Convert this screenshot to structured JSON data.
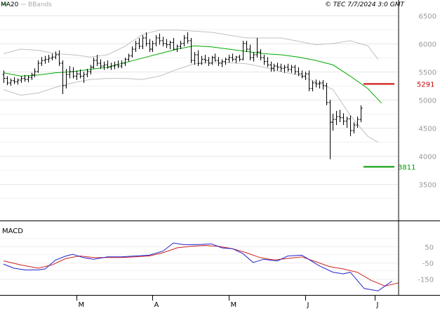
{
  "chart_data": [
    {
      "type": "ohlc",
      "header": {
        "ma_label": "MA20",
        "bb_label": "BBands",
        "source_label": "© TEC 7/7/2024 3:0 GMT"
      },
      "colors": {
        "candle": "#000000",
        "ma": "#00aa00",
        "bands": "#c0c0c0",
        "resistance": "#cc0000",
        "support": "#009900",
        "grid": "#e6e6e6"
      },
      "ylim": [
        3000,
        6600
      ],
      "y_ticks": [
        3500,
        4000,
        4500,
        5000,
        5500,
        6000,
        6500
      ],
      "x_labels": [
        "M",
        "A",
        "M",
        "J",
        "J"
      ],
      "x_label_index": [
        21,
        43,
        65,
        87,
        107
      ],
      "levels": [
        {
          "name": "resistance",
          "value": 5291,
          "label": "5291"
        },
        {
          "name": "support",
          "value": 3811,
          "label": "3811"
        }
      ],
      "ohlc": [
        [
          5450,
          5520,
          5300,
          5380
        ],
        [
          5380,
          5420,
          5260,
          5300
        ],
        [
          5300,
          5380,
          5250,
          5340
        ],
        [
          5340,
          5400,
          5280,
          5320
        ],
        [
          5320,
          5380,
          5270,
          5350
        ],
        [
          5350,
          5420,
          5300,
          5380
        ],
        [
          5380,
          5440,
          5320,
          5360
        ],
        [
          5360,
          5430,
          5310,
          5400
        ],
        [
          5400,
          5480,
          5350,
          5440
        ],
        [
          5440,
          5560,
          5400,
          5500
        ],
        [
          5500,
          5700,
          5480,
          5650
        ],
        [
          5650,
          5760,
          5600,
          5700
        ],
        [
          5700,
          5780,
          5640,
          5720
        ],
        [
          5720,
          5800,
          5660,
          5740
        ],
        [
          5740,
          5820,
          5700,
          5760
        ],
        [
          5760,
          5860,
          5720,
          5800
        ],
        [
          5800,
          5880,
          5600,
          5650
        ],
        [
          5650,
          5700,
          5100,
          5250
        ],
        [
          5250,
          5550,
          5200,
          5450
        ],
        [
          5450,
          5600,
          5380,
          5500
        ],
        [
          5500,
          5580,
          5380,
          5420
        ],
        [
          5420,
          5520,
          5350,
          5460
        ],
        [
          5460,
          5540,
          5380,
          5420
        ],
        [
          5420,
          5500,
          5300,
          5450
        ],
        [
          5450,
          5550,
          5400,
          5500
        ],
        [
          5500,
          5620,
          5450,
          5580
        ],
        [
          5580,
          5750,
          5550,
          5700
        ],
        [
          5700,
          5800,
          5600,
          5650
        ],
        [
          5650,
          5720,
          5550,
          5600
        ],
        [
          5600,
          5680,
          5530,
          5620
        ],
        [
          5620,
          5700,
          5550,
          5580
        ],
        [
          5580,
          5660,
          5530,
          5600
        ],
        [
          5600,
          5680,
          5540,
          5620
        ],
        [
          5620,
          5700,
          5560,
          5600
        ],
        [
          5600,
          5700,
          5560,
          5650
        ],
        [
          5650,
          5750,
          5600,
          5720
        ],
        [
          5720,
          5820,
          5680,
          5780
        ],
        [
          5780,
          5950,
          5750,
          5900
        ],
        [
          5900,
          6050,
          5850,
          6000
        ],
        [
          6000,
          6100,
          5900,
          5950
        ],
        [
          5950,
          6150,
          5900,
          6100
        ],
        [
          6100,
          6200,
          5950,
          6000
        ],
        [
          6000,
          6080,
          5850,
          5900
        ],
        [
          5900,
          6050,
          5850,
          6000
        ],
        [
          6000,
          6150,
          5950,
          6100
        ],
        [
          6100,
          6180,
          5980,
          6050
        ],
        [
          6050,
          6120,
          5950,
          6000
        ],
        [
          6000,
          6080,
          5920,
          5980
        ],
        [
          5980,
          6050,
          5900,
          6020
        ],
        [
          6020,
          6100,
          5880,
          5900
        ],
        [
          5900,
          5980,
          5850,
          5950
        ],
        [
          5950,
          6050,
          5900,
          6000
        ],
        [
          6000,
          6150,
          5950,
          6100
        ],
        [
          6100,
          6200,
          6000,
          6050
        ],
        [
          6050,
          6100,
          5650,
          5700
        ],
        [
          5700,
          5850,
          5620,
          5800
        ],
        [
          5800,
          5880,
          5600,
          5650
        ],
        [
          5650,
          5780,
          5620,
          5720
        ],
        [
          5720,
          5800,
          5650,
          5700
        ],
        [
          5700,
          5760,
          5600,
          5650
        ],
        [
          5650,
          5780,
          5620,
          5750
        ],
        [
          5750,
          5820,
          5680,
          5700
        ],
        [
          5700,
          5760,
          5600,
          5650
        ],
        [
          5650,
          5720,
          5580,
          5680
        ],
        [
          5680,
          5750,
          5620,
          5720
        ],
        [
          5720,
          5800,
          5660,
          5750
        ],
        [
          5750,
          5820,
          5680,
          5720
        ],
        [
          5720,
          5780,
          5650,
          5760
        ],
        [
          5760,
          5800,
          5680,
          5720
        ],
        [
          5720,
          6050,
          5700,
          6000
        ],
        [
          6000,
          6050,
          5850,
          5900
        ],
        [
          5900,
          5980,
          5700,
          5750
        ],
        [
          5750,
          5850,
          5680,
          5800
        ],
        [
          5800,
          6100,
          5750,
          5850
        ],
        [
          5850,
          5900,
          5700,
          5750
        ],
        [
          5750,
          5800,
          5620,
          5680
        ],
        [
          5680,
          5760,
          5580,
          5620
        ],
        [
          5620,
          5680,
          5500,
          5560
        ],
        [
          5560,
          5640,
          5500,
          5600
        ],
        [
          5600,
          5660,
          5520,
          5580
        ],
        [
          5580,
          5640,
          5500,
          5560
        ],
        [
          5560,
          5620,
          5480,
          5580
        ],
        [
          5580,
          5640,
          5500,
          5540
        ],
        [
          5540,
          5620,
          5480,
          5580
        ],
        [
          5580,
          5620,
          5450,
          5500
        ],
        [
          5500,
          5580,
          5420,
          5460
        ],
        [
          5460,
          5520,
          5380,
          5420
        ],
        [
          5420,
          5500,
          5350,
          5460
        ],
        [
          5460,
          5520,
          5150,
          5200
        ],
        [
          5200,
          5340,
          5150,
          5300
        ],
        [
          5300,
          5360,
          5220,
          5280
        ],
        [
          5280,
          5340,
          5200,
          5300
        ],
        [
          5300,
          5350,
          5180,
          5250
        ],
        [
          5250,
          5300,
          4900,
          4950
        ],
        [
          4950,
          5000,
          3940,
          4600
        ],
        [
          4600,
          4750,
          4450,
          4650
        ],
        [
          4650,
          4800,
          4550,
          4700
        ],
        [
          4700,
          4820,
          4600,
          4680
        ],
        [
          4680,
          4760,
          4550,
          4620
        ],
        [
          4620,
          4700,
          4500,
          4660
        ],
        [
          4660,
          4720,
          4350,
          4450
        ],
        [
          4450,
          4600,
          4400,
          4550
        ],
        [
          4550,
          4700,
          4500,
          4650
        ],
        [
          4650,
          4900,
          4600,
          4850
        ]
      ],
      "ma20": [
        [
          0,
          5480
        ],
        [
          5,
          5420
        ],
        [
          10,
          5440
        ],
        [
          15,
          5480
        ],
        [
          20,
          5500
        ],
        [
          25,
          5540
        ],
        [
          30,
          5580
        ],
        [
          35,
          5660
        ],
        [
          40,
          5740
        ],
        [
          45,
          5820
        ],
        [
          50,
          5900
        ],
        [
          55,
          5960
        ],
        [
          60,
          5940
        ],
        [
          65,
          5900
        ],
        [
          70,
          5860
        ],
        [
          75,
          5820
        ],
        [
          80,
          5800
        ],
        [
          85,
          5760
        ],
        [
          90,
          5700
        ],
        [
          95,
          5620
        ],
        [
          100,
          5420
        ],
        [
          105,
          5200
        ],
        [
          109,
          4940
        ]
      ],
      "bb_upper": [
        [
          0,
          5820
        ],
        [
          5,
          5900
        ],
        [
          10,
          5880
        ],
        [
          15,
          5820
        ],
        [
          20,
          5800
        ],
        [
          25,
          5760
        ],
        [
          30,
          5800
        ],
        [
          35,
          5950
        ],
        [
          40,
          6160
        ],
        [
          45,
          6240
        ],
        [
          50,
          6240
        ],
        [
          55,
          6220
        ],
        [
          60,
          6200
        ],
        [
          65,
          6150
        ],
        [
          70,
          6100
        ],
        [
          75,
          6100
        ],
        [
          80,
          6100
        ],
        [
          85,
          6040
        ],
        [
          90,
          5980
        ],
        [
          95,
          6000
        ],
        [
          100,
          6050
        ],
        [
          105,
          5960
        ],
        [
          108,
          5720
        ]
      ],
      "bb_lower": [
        [
          0,
          5180
        ],
        [
          5,
          5080
        ],
        [
          10,
          5120
        ],
        [
          15,
          5220
        ],
        [
          20,
          5300
        ],
        [
          25,
          5360
        ],
        [
          30,
          5380
        ],
        [
          35,
          5380
        ],
        [
          40,
          5360
        ],
        [
          45,
          5420
        ],
        [
          50,
          5540
        ],
        [
          55,
          5640
        ],
        [
          60,
          5660
        ],
        [
          65,
          5660
        ],
        [
          70,
          5640
        ],
        [
          75,
          5580
        ],
        [
          80,
          5500
        ],
        [
          85,
          5440
        ],
        [
          90,
          5320
        ],
        [
          95,
          5180
        ],
        [
          100,
          4720
        ],
        [
          105,
          4350
        ],
        [
          108,
          4240
        ]
      ]
    },
    {
      "type": "line",
      "title": "MACD",
      "ylim": [
        -250,
        200
      ],
      "y_ticks": [
        50,
        -50,
        -150
      ],
      "y_tick_labels": [
        "50",
        "-50",
        "-150"
      ],
      "colors": {
        "macd": "#2222cc",
        "signal": "#cc2222"
      },
      "macd": [
        [
          0,
          -60
        ],
        [
          3,
          -85
        ],
        [
          6,
          -95
        ],
        [
          10,
          -95
        ],
        [
          12,
          -90
        ],
        [
          15,
          -35
        ],
        [
          18,
          -10
        ],
        [
          20,
          0
        ],
        [
          23,
          -20
        ],
        [
          26,
          -30
        ],
        [
          30,
          -15
        ],
        [
          34,
          -15
        ],
        [
          38,
          -10
        ],
        [
          42,
          -5
        ],
        [
          46,
          20
        ],
        [
          49,
          70
        ],
        [
          52,
          60
        ],
        [
          56,
          60
        ],
        [
          60,
          65
        ],
        [
          63,
          40
        ],
        [
          66,
          35
        ],
        [
          69,
          5
        ],
        [
          72,
          -50
        ],
        [
          75,
          -30
        ],
        [
          79,
          -40
        ],
        [
          82,
          -10
        ],
        [
          86,
          -5
        ],
        [
          88,
          -30
        ],
        [
          91,
          -70
        ],
        [
          95,
          -110
        ],
        [
          98,
          -120
        ],
        [
          100,
          -110
        ],
        [
          102,
          -160
        ],
        [
          104,
          -210
        ],
        [
          108,
          -225
        ],
        [
          112,
          -165
        ]
      ],
      "signal": [
        [
          0,
          -40
        ],
        [
          5,
          -65
        ],
        [
          10,
          -85
        ],
        [
          14,
          -65
        ],
        [
          18,
          -25
        ],
        [
          22,
          -10
        ],
        [
          26,
          -20
        ],
        [
          30,
          -20
        ],
        [
          34,
          -20
        ],
        [
          38,
          -15
        ],
        [
          42,
          -10
        ],
        [
          46,
          10
        ],
        [
          50,
          40
        ],
        [
          54,
          50
        ],
        [
          58,
          55
        ],
        [
          62,
          50
        ],
        [
          66,
          35
        ],
        [
          70,
          10
        ],
        [
          74,
          -20
        ],
        [
          78,
          -35
        ],
        [
          82,
          -25
        ],
        [
          86,
          -15
        ],
        [
          90,
          -45
        ],
        [
          94,
          -75
        ],
        [
          98,
          -90
        ],
        [
          102,
          -110
        ],
        [
          106,
          -160
        ],
        [
          110,
          -195
        ],
        [
          114,
          -175
        ]
      ]
    }
  ]
}
